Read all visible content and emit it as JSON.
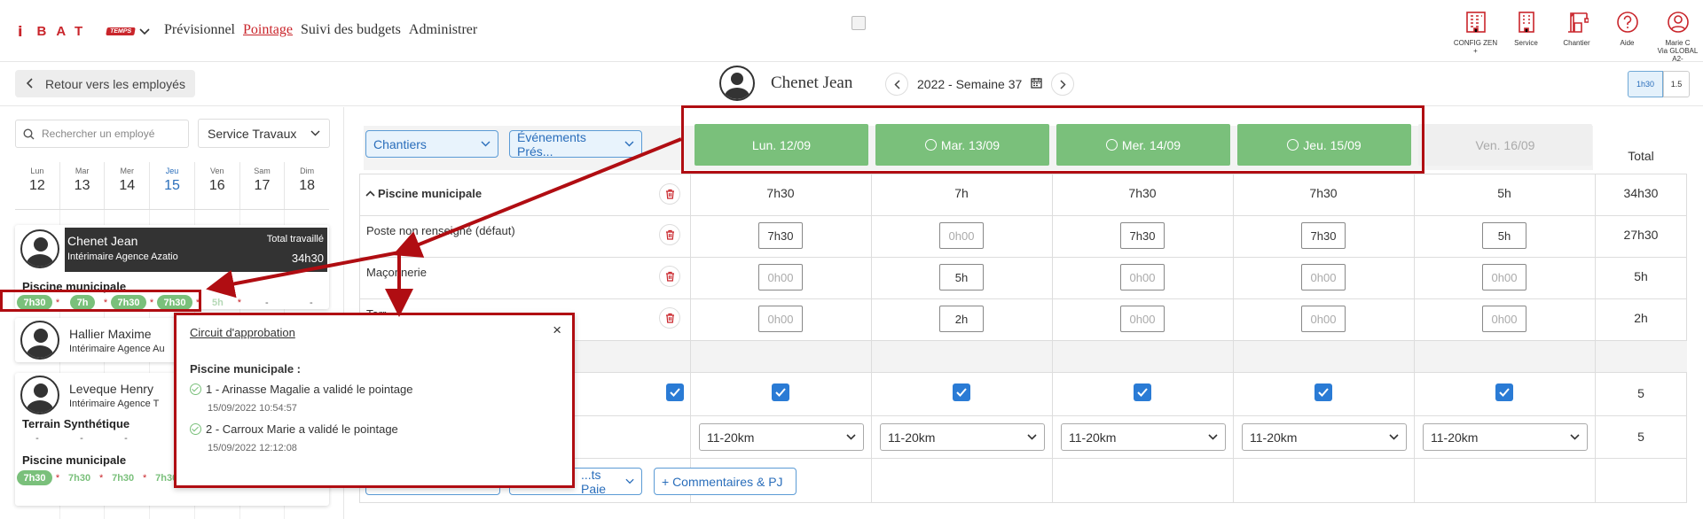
{
  "brand": {
    "letters": "i",
    "name": "BAT",
    "tag": "TEMPS"
  },
  "nav": [
    "Prévisionnel",
    "Pointage",
    "Suivi des budgets",
    "Administrer"
  ],
  "nav_active": "Pointage",
  "top_icons": [
    {
      "icon": "building-icon",
      "label": "CONFIG ZEN",
      "sub": "+"
    },
    {
      "icon": "building-icon",
      "label": "Service",
      "sub": ""
    },
    {
      "icon": "crane-icon",
      "label": "Chantier",
      "sub": ""
    },
    {
      "icon": "help-icon",
      "label": "Aide",
      "sub": ""
    },
    {
      "icon": "user-icon",
      "label": "Marie C",
      "sub": "Via GLOBAL A2-"
    }
  ],
  "back_label": "Retour vers les employés",
  "employee": "Chenet Jean",
  "week": "2022 - Semaine 37",
  "toggle": [
    "1h30",
    "1.5"
  ],
  "search_placeholder": "Rechercher un employé",
  "service": "Service Travaux",
  "days": [
    {
      "n": "Lun",
      "d": "12"
    },
    {
      "n": "Mar",
      "d": "13"
    },
    {
      "n": "Mer",
      "d": "14"
    },
    {
      "n": "Jeu",
      "d": "15"
    },
    {
      "n": "Ven",
      "d": "16"
    },
    {
      "n": "Sam",
      "d": "17"
    },
    {
      "n": "Dim",
      "d": "18"
    }
  ],
  "emp1": {
    "name": "Chenet Jean",
    "company": "Intérimaire Agence Azatio",
    "total_label": "Total travaillé",
    "total": "34h30",
    "site": "Piscine municipale",
    "hours": [
      "7h30",
      "7h",
      "7h30",
      "7h30",
      "5h",
      "-",
      "-"
    ]
  },
  "emp2": {
    "name": "Hallier Maxime",
    "company": "Intérimaire Agence Au"
  },
  "emp3": {
    "name": "Leveque Henry",
    "company": "Intérimaire Agence T",
    "site1": "Terrain Synthétique",
    "site2": "Piscine municipale",
    "dashes": [
      "-",
      "-",
      "-"
    ],
    "hours": [
      "7h30",
      "7h30",
      "7h30",
      "7h30",
      "-",
      "-"
    ]
  },
  "filters": {
    "chantiers": "Chantiers",
    "evenements": "Événements Prés..."
  },
  "day_headers": [
    "Lun. 12/09",
    "Mar. 13/09",
    "Mer. 14/09",
    "Jeu. 15/09",
    "Ven. 16/09"
  ],
  "total_label": "Total",
  "site_row": {
    "label": "Piscine municipale",
    "values": [
      "7h30",
      "7h",
      "7h30",
      "7h30",
      "5h"
    ],
    "total": "34h30"
  },
  "rows": [
    {
      "label": "Poste non renseigné (défaut)",
      "values": [
        "7h30",
        "0h00",
        "7h30",
        "7h30",
        "5h"
      ],
      "total": "27h30"
    },
    {
      "label": "Maçonnerie",
      "values": [
        "0h00",
        "5h",
        "0h00",
        "0h00",
        "0h00"
      ],
      "total": "5h"
    },
    {
      "label": "Terr...",
      "values": [
        "0h00",
        "2h",
        "0h00",
        "0h00",
        "0h00"
      ],
      "total": "2h"
    }
  ],
  "check_total": "5",
  "distance_values": [
    "11-20km",
    "11-20km",
    "11-20km",
    "11-20km",
    "11-20km"
  ],
  "distance_total": "5",
  "bottom": {
    "paie": "...ts Paie",
    "comments": "+ Commentaires & PJ"
  },
  "popup": {
    "title": "Circuit d'approbation",
    "site": "Piscine municipale :",
    "steps": [
      {
        "text": "1 - Arinasse Magalie a validé le pointage",
        "date": "15/09/2022 10:54:57"
      },
      {
        "text": "2 - Carroux Marie a validé le pointage",
        "date": "15/09/2022 12:12:08"
      }
    ]
  },
  "colors": {
    "brand": "#c9252b",
    "approved": "#7ac07b",
    "link": "#2a6ebb",
    "annotation": "#b00d12"
  }
}
